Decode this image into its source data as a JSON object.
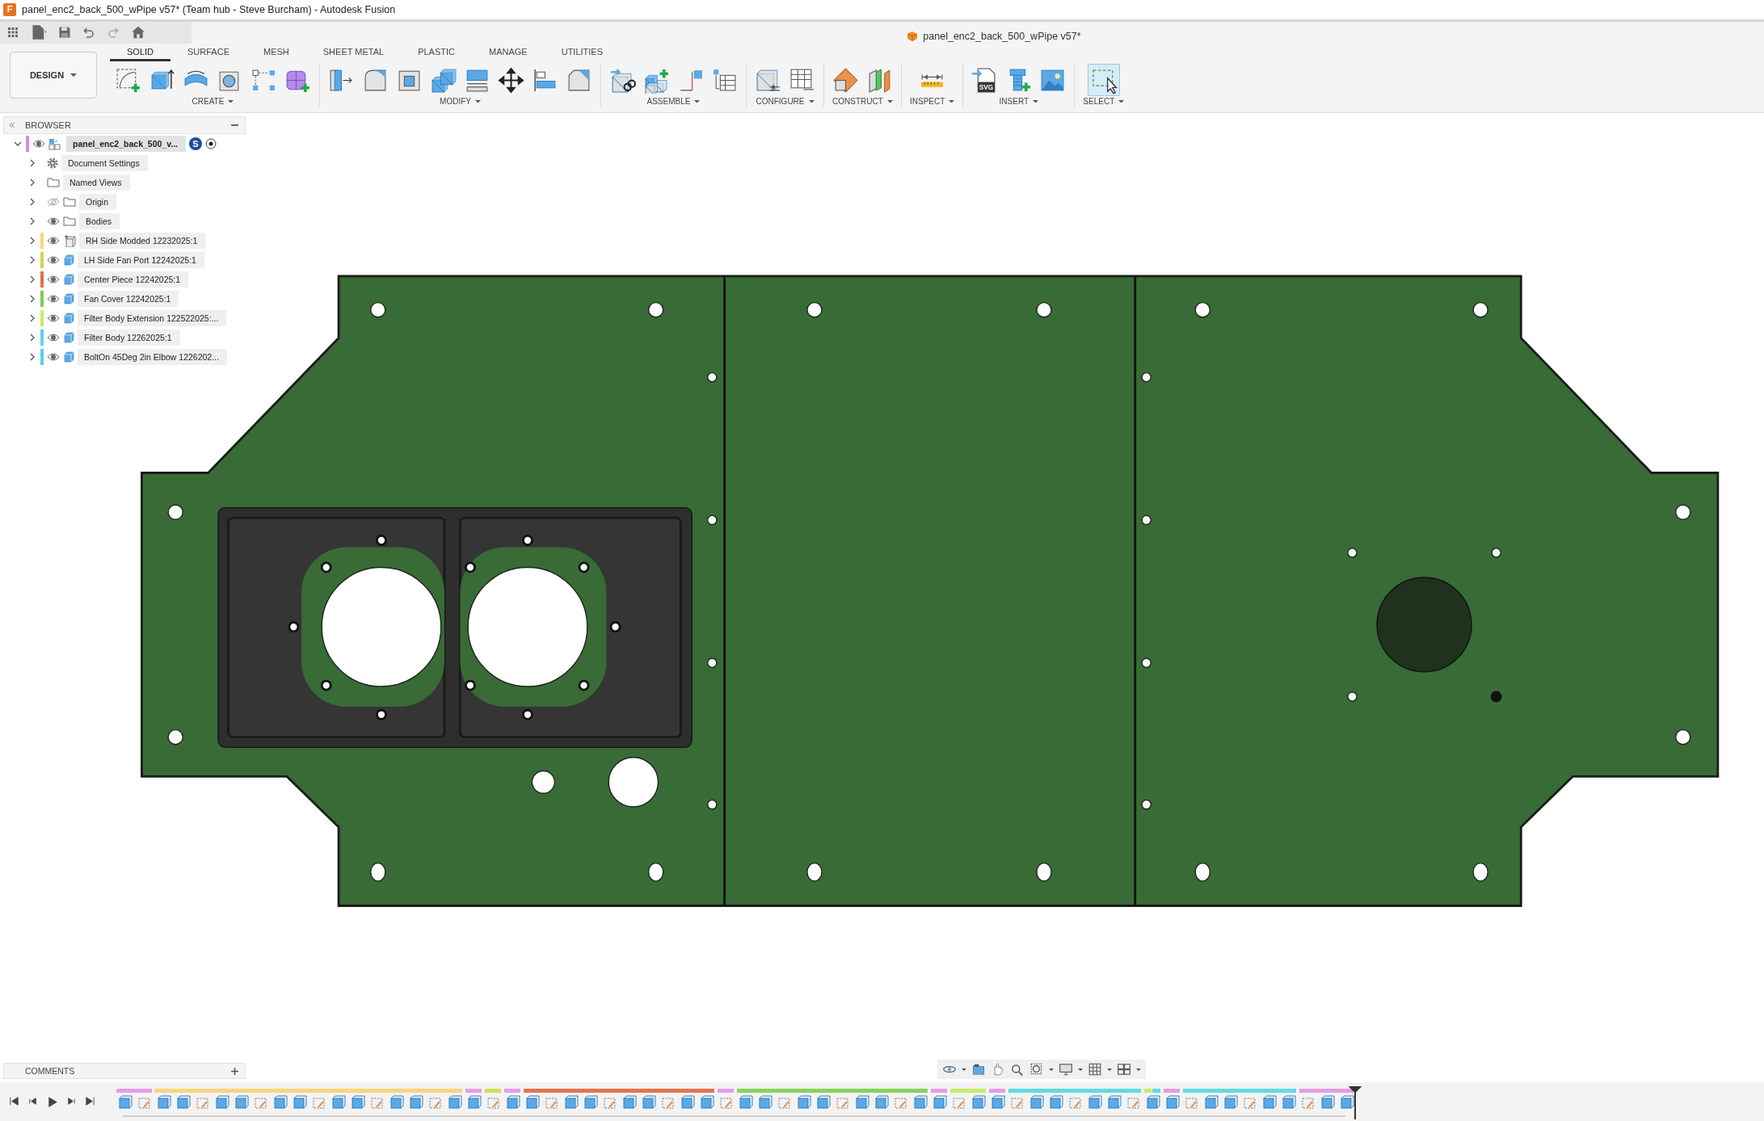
{
  "window": {
    "title": "panel_enc2_back_500_wPipe v57* (Team hub - Steve Burcham) - Autodesk Fusion",
    "icon_letter": "F"
  },
  "document_tab": {
    "title": "panel_enc2_back_500_wPipe v57*"
  },
  "workspace": {
    "label": "DESIGN"
  },
  "ribbon": {
    "tabs": [
      {
        "label": "SOLID",
        "selected": true
      },
      {
        "label": "SURFACE",
        "selected": false
      },
      {
        "label": "MESH",
        "selected": false
      },
      {
        "label": "SHEET METAL",
        "selected": false
      },
      {
        "label": "PLASTIC",
        "selected": false
      },
      {
        "label": "MANAGE",
        "selected": false
      },
      {
        "label": "UTILITIES",
        "selected": false
      }
    ],
    "groups": [
      {
        "label": "CREATE"
      },
      {
        "label": "MODIFY"
      },
      {
        "label": "ASSEMBLE"
      },
      {
        "label": "CONFIGURE"
      },
      {
        "label": "CONSTRUCT"
      },
      {
        "label": "INSPECT"
      },
      {
        "label": "INSERT",
        "svg_icon_text": "SVG"
      },
      {
        "label": "SELECT"
      }
    ]
  },
  "browser": {
    "title": "BROWSER",
    "root": {
      "label": "panel_enc2_back_500_v...",
      "expanded": true,
      "visible": true,
      "color": "#d98be0",
      "owner_badge": "S",
      "children": [
        {
          "kind": "settings",
          "label": "Document Settings",
          "expanded": false
        },
        {
          "kind": "folder",
          "label": "Named Views",
          "expanded": false
        },
        {
          "kind": "folder",
          "label": "Origin",
          "expanded": false,
          "visible": false
        },
        {
          "kind": "folder",
          "label": "Bodies",
          "expanded": false,
          "visible": true
        },
        {
          "kind": "anchored-component",
          "label": "RH Side Modded 12232025:1",
          "expanded": false,
          "visible": true,
          "color": "#f9d57f"
        },
        {
          "kind": "component",
          "label": "LH Side Fan Port 12242025:1",
          "expanded": false,
          "visible": true,
          "color": "#d4d44a"
        },
        {
          "kind": "component",
          "label": "Center Piece 12242025:1",
          "expanded": false,
          "visible": true,
          "color": "#e2714a"
        },
        {
          "kind": "component",
          "label": "Fan Cover 12242025:1",
          "expanded": false,
          "visible": true,
          "color": "#7ccc4e"
        },
        {
          "kind": "component",
          "label": "Filter Body Extension 122522025:...",
          "expanded": false,
          "visible": true,
          "color": "#c6ec6a"
        },
        {
          "kind": "component",
          "label": "Filter Body 12262025:1",
          "expanded": false,
          "visible": true,
          "color": "#5fd3dc"
        },
        {
          "kind": "component",
          "label": "BoltOn 45Deg 2in Elbow 1226202...",
          "expanded": false,
          "visible": true,
          "color": "#4fd0ef"
        }
      ]
    }
  },
  "comments": {
    "title": "COMMENTS"
  }
}
